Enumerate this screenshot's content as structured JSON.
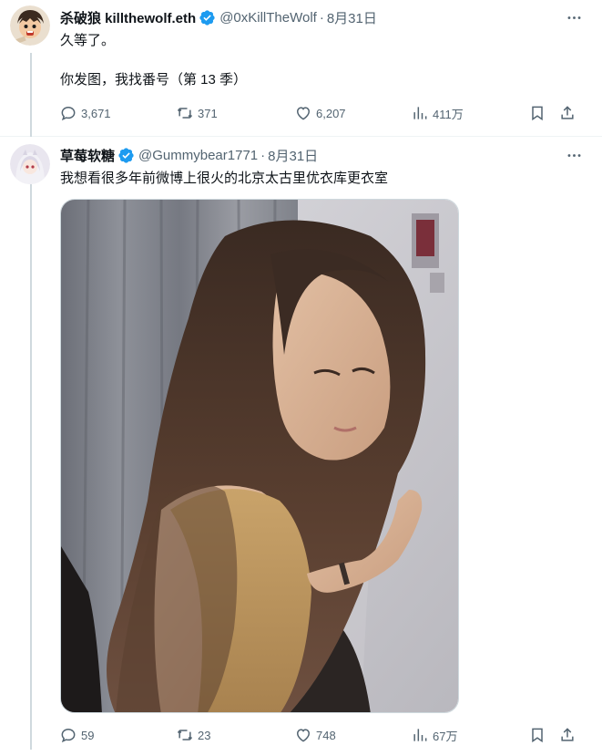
{
  "tweets": [
    {
      "display_name": "杀破狼 killthewolf.eth",
      "handle": "@0xKillTheWolf",
      "dot": "·",
      "date": "8月31日",
      "text_lines": [
        "久等了。",
        "你发图，我找番号（第 13 季）"
      ],
      "stats": {
        "reply": "3,671",
        "retweet": "371",
        "like": "6,207",
        "views": "411万"
      }
    },
    {
      "display_name": "草莓软糖",
      "handle": "@Gummybear1771",
      "dot": "·",
      "date": "8月31日",
      "text_lines": [
        "我想看很多年前微博上很火的北京太古里优衣库更衣室"
      ],
      "stats": {
        "reply": "59",
        "retweet": "23",
        "like": "748",
        "views": "67万"
      }
    }
  ],
  "colors": {
    "verified": "#1d9bf0",
    "muted": "#536471",
    "text": "#0f1419"
  },
  "icons": [
    "verified-badge-icon",
    "more-icon",
    "reply-icon",
    "retweet-icon",
    "like-icon",
    "views-icon",
    "bookmark-icon",
    "share-icon"
  ]
}
